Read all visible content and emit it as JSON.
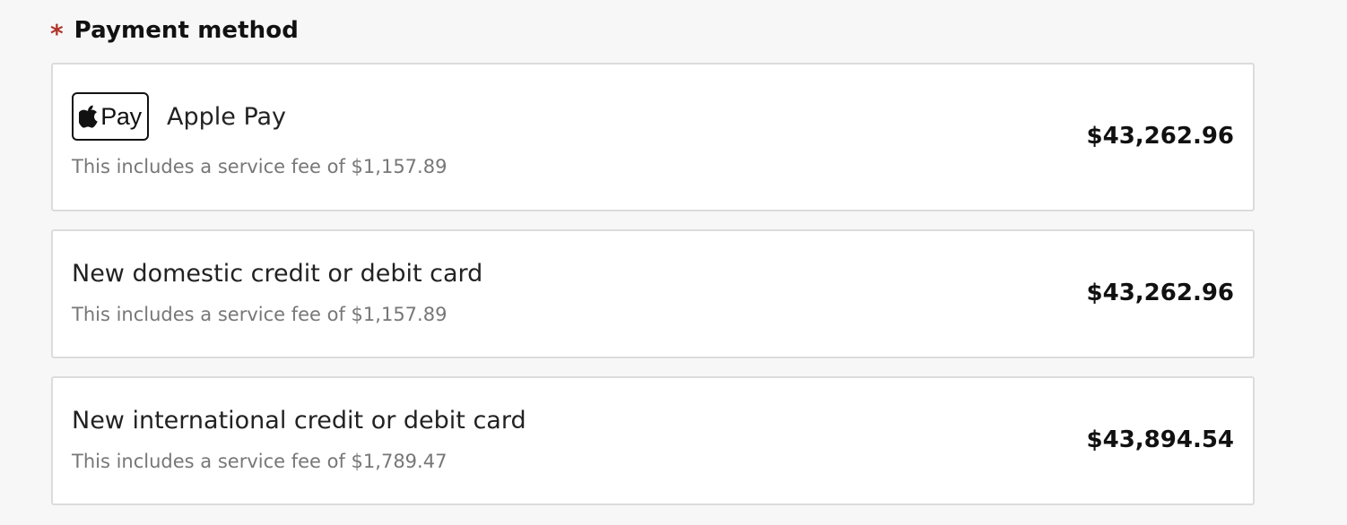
{
  "payment": {
    "required_marker": "*",
    "title": "Payment method",
    "colors": {
      "required": "#b0352c",
      "border": "#dcdcdc",
      "fee_text": "#777777"
    },
    "options": [
      {
        "icon": "apple-pay-logo",
        "badge_text": "Pay",
        "label": "Apple Pay",
        "fee": "This includes a service fee of $1,157.89",
        "price": "$43,262.96"
      },
      {
        "label": "New domestic credit or debit card",
        "fee": "This includes a service fee of $1,157.89",
        "price": "$43,262.96"
      },
      {
        "label": "New international credit or debit card",
        "fee": "This includes a service fee of $1,789.47",
        "price": "$43,894.54"
      }
    ]
  }
}
